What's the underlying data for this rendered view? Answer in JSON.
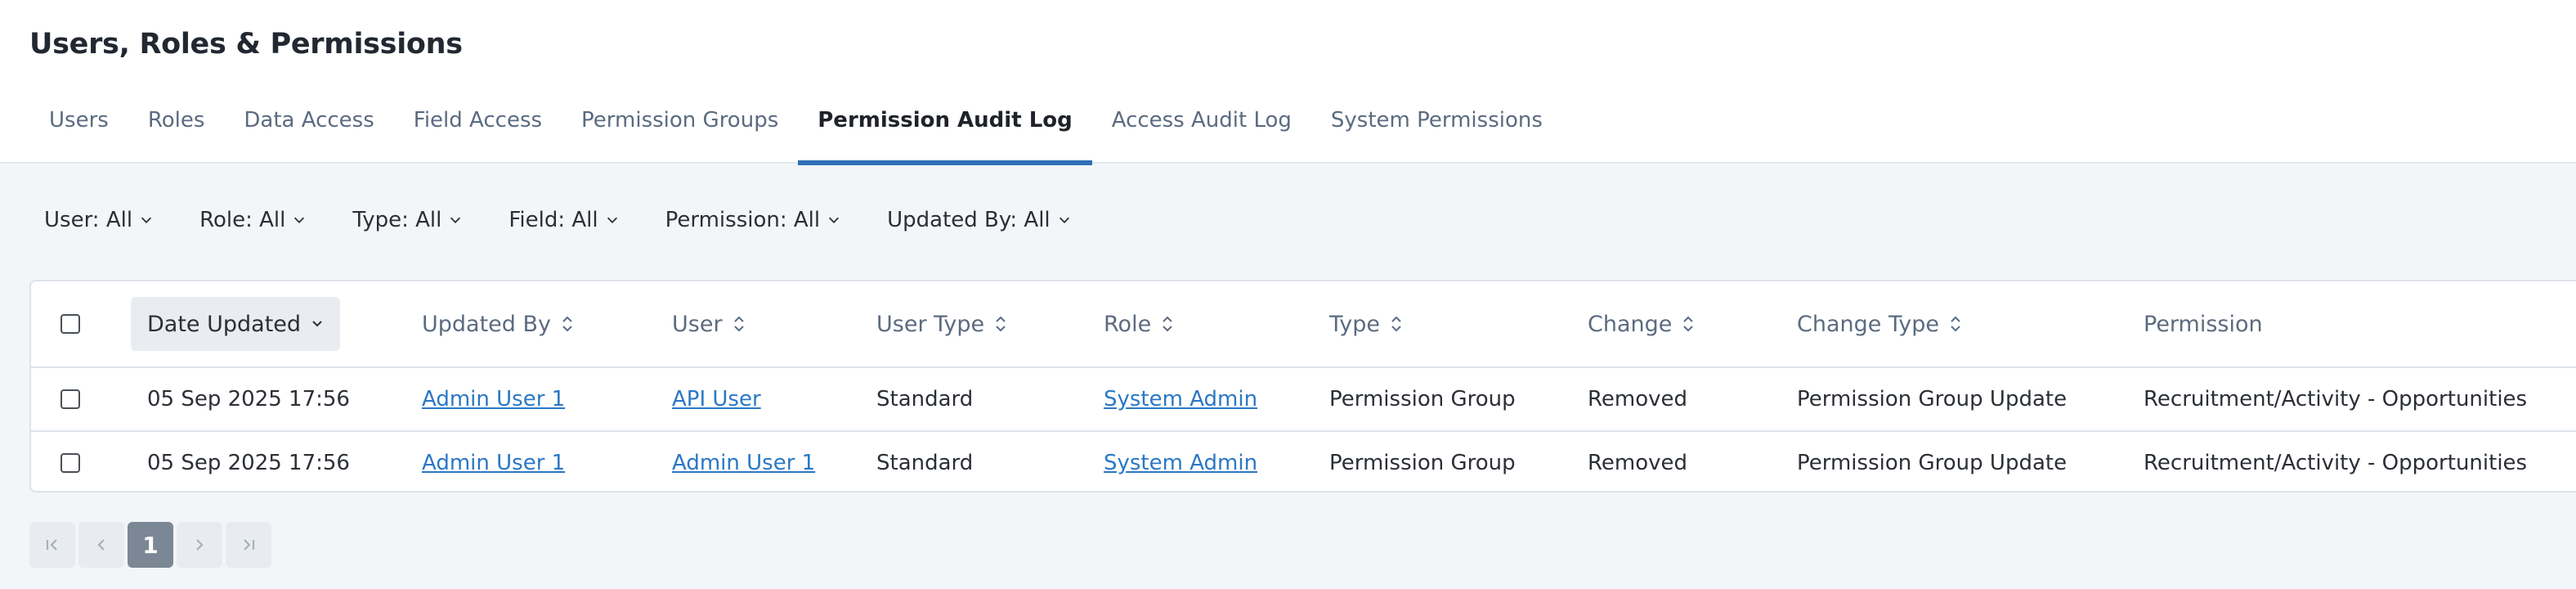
{
  "page": {
    "title": "Users, Roles & Permissions"
  },
  "tabs": [
    {
      "label": "Users"
    },
    {
      "label": "Roles"
    },
    {
      "label": "Data Access"
    },
    {
      "label": "Field Access"
    },
    {
      "label": "Permission Groups"
    },
    {
      "label": "Permission Audit Log",
      "active": true
    },
    {
      "label": "Access Audit Log"
    },
    {
      "label": "System Permissions"
    }
  ],
  "filters": [
    {
      "label": "User: All"
    },
    {
      "label": "Role: All"
    },
    {
      "label": "Type: All"
    },
    {
      "label": "Field: All"
    },
    {
      "label": "Permission: All"
    },
    {
      "label": "Updated By: All"
    }
  ],
  "table": {
    "columns": {
      "date_updated": "Date Updated",
      "updated_by": "Updated By",
      "user": "User",
      "user_type": "User Type",
      "role": "Role",
      "type": "Type",
      "change": "Change",
      "change_type": "Change Type",
      "permission": "Permission"
    },
    "rows": [
      {
        "date_updated": "05 Sep 2025 17:56",
        "updated_by": "Admin User 1",
        "user": "API User",
        "user_type": "Standard",
        "role": "System Admin",
        "type": "Permission Group",
        "change": "Removed",
        "change_type": "Permission Group Update",
        "permission": "Recruitment/Activity - Opportunities"
      },
      {
        "date_updated": "05 Sep 2025 17:56",
        "updated_by": "Admin User 1",
        "user": "Admin User 1",
        "user_type": "Standard",
        "role": "System Admin",
        "type": "Permission Group",
        "change": "Removed",
        "change_type": "Permission Group Update",
        "permission": "Recruitment/Activity - Opportunities"
      }
    ]
  },
  "pagination": {
    "current_page": "1"
  },
  "colors": {
    "accent": "#2f6fb6",
    "link": "#2b78c5",
    "page_bg": "#f3f6f9"
  }
}
